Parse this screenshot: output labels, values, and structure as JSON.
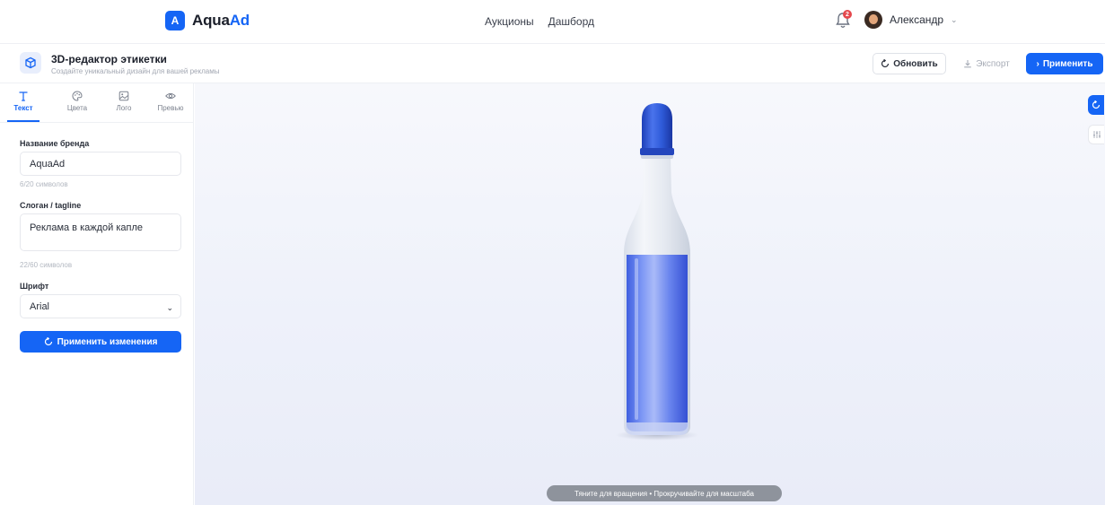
{
  "brand": {
    "badge": "A",
    "name_part1": "Aqua",
    "name_part2": "Ad"
  },
  "nav": {
    "auctions": "Аукционы",
    "dashboard": "Дашборд"
  },
  "notifications": {
    "count": "2"
  },
  "user": {
    "name": "Александр"
  },
  "editor": {
    "title": "3D-редактор этикетки",
    "subtitle": "Создайте уникальный дизайн для вашей рекламы",
    "refresh_label": "Обновить",
    "export_label": "Экспорт",
    "apply_label": "Применить"
  },
  "tabs": [
    {
      "label": "Текст",
      "icon": "text-icon",
      "active": true
    },
    {
      "label": "Цвета",
      "icon": "palette-icon",
      "active": false
    },
    {
      "label": "Лого",
      "icon": "image-icon",
      "active": false
    },
    {
      "label": "Превью",
      "icon": "eye-icon",
      "active": false
    }
  ],
  "form": {
    "brand_label": "Название бренда",
    "brand_value": "AquaAd",
    "brand_counter": "6/20 символов",
    "tagline_label": "Слоган / tagline",
    "tagline_value": "Реклама в каждой капле",
    "tagline_counter": "22/60 символов",
    "font_label": "Шрифт",
    "font_value": "Arial",
    "apply_changes_label": "Применить изменения"
  },
  "viewer": {
    "hint": "Тяните для вращения • Прокручивайте для масштаба",
    "liquid_color": "#5d7cf0",
    "cap_color": "#2f5bd9"
  },
  "colors": {
    "accent": "#1565f5"
  }
}
